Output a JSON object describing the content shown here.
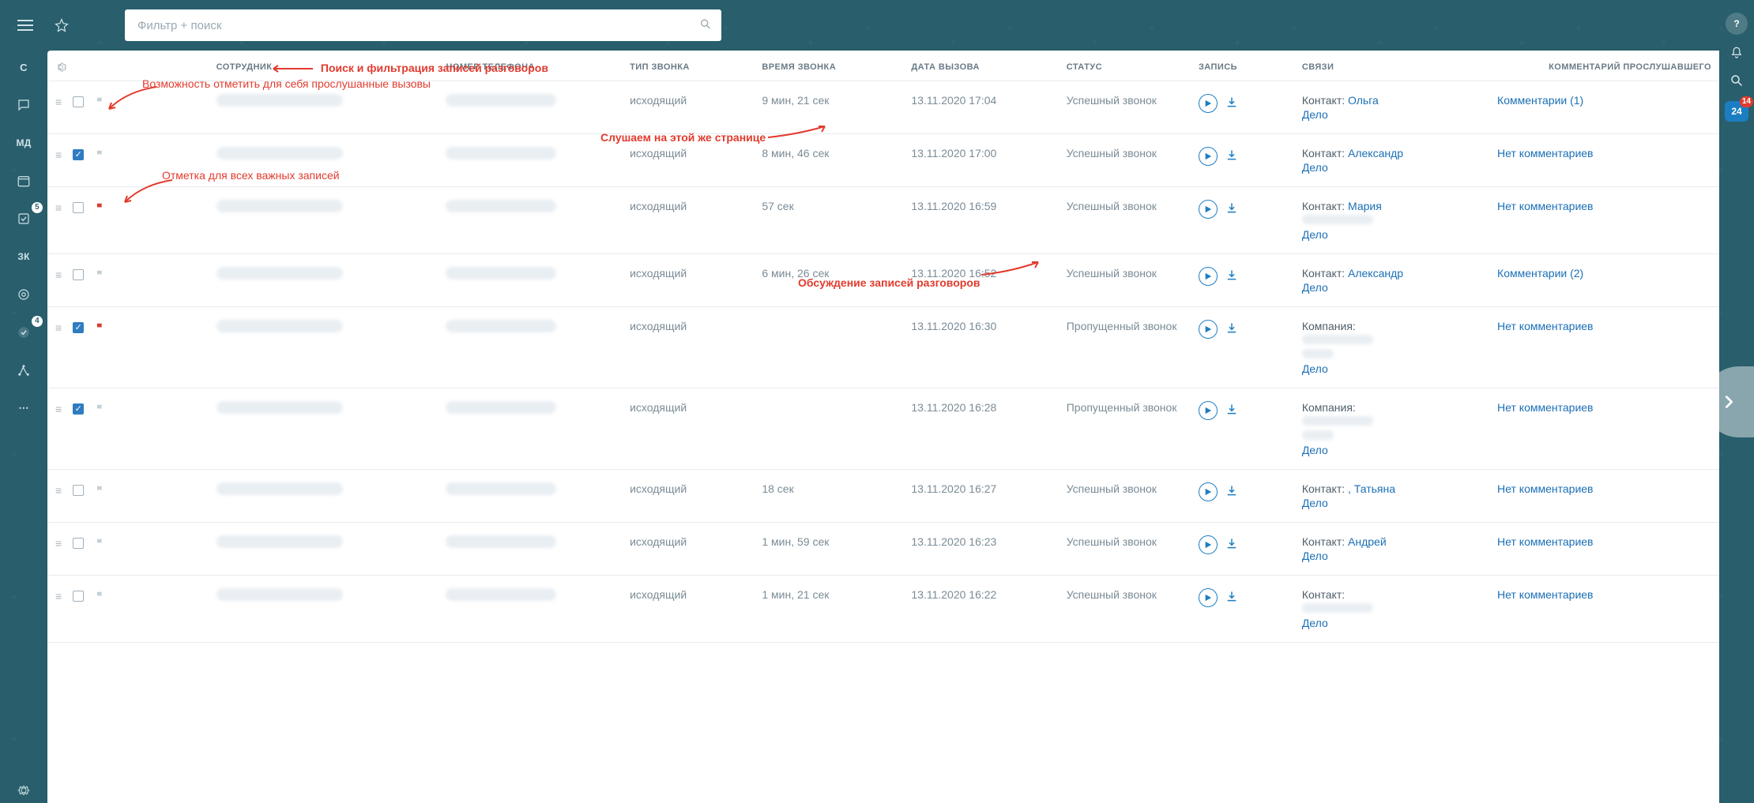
{
  "search": {
    "placeholder": "Фильтр + поиск"
  },
  "annotations": {
    "search": "Поиск и фильтрация записей разговоров",
    "self_check": "Возможность отметить для себя прослушанные вызовы",
    "flag_important": "Отметка для всех важных записей",
    "listen_inline": "Слушаем на этой же странице",
    "discussion": "Обсуждение записей разговоров"
  },
  "sidebar": {
    "items": [
      "С",
      "",
      "МД",
      "",
      "",
      "ЗК",
      "",
      "",
      "",
      ""
    ],
    "badge_box": 5,
    "badge_accept": 4
  },
  "rail": {
    "brand_num": "24",
    "brand_badge": "14"
  },
  "headers": {
    "employee": "СОТРУДНИК",
    "phone": "НОМЕР ТЕЛЕФОНА",
    "type": "ТИП ЗВОНКА",
    "duration": "ВРЕМЯ ЗВОНКА",
    "date": "ДАТА ВЫЗОВА",
    "status": "СТАТУС",
    "record": "ЗАПИСЬ",
    "relations": "СВЯЗИ",
    "comment": "КОММЕНТАРИЙ ПРОСЛУШАВШЕГО"
  },
  "labels": {
    "contact": "Контакт:",
    "company": "Компания:",
    "deal": "Дело"
  },
  "rows": [
    {
      "checked": false,
      "flag": "gray",
      "type": "исходящий",
      "duration": "9 мин, 21 сек",
      "date": "13.11.2020 17:04",
      "status": "Успешный звонок",
      "relation_kind": "contact",
      "contact": "Ольга",
      "contact_extra": false,
      "comment": "Комментарии (1)"
    },
    {
      "checked": true,
      "flag": "gray",
      "type": "исходящий",
      "duration": "8 мин, 46 сек",
      "date": "13.11.2020 17:00",
      "status": "Успешный звонок",
      "relation_kind": "contact",
      "contact": "Александр",
      "contact_extra": false,
      "comment": "Нет комментариев"
    },
    {
      "checked": false,
      "flag": "red",
      "type": "исходящий",
      "duration": "57 сек",
      "date": "13.11.2020 16:59",
      "status": "Успешный звонок",
      "relation_kind": "contact",
      "contact": "Мария",
      "contact_extra": true,
      "comment": "Нет комментариев"
    },
    {
      "checked": false,
      "flag": "gray",
      "type": "исходящий",
      "duration": "6 мин, 26 сек",
      "date": "13.11.2020 16:52",
      "status": "Успешный звонок",
      "relation_kind": "contact",
      "contact": "Александр",
      "contact_extra": false,
      "comment": "Комментарии (2)"
    },
    {
      "checked": true,
      "flag": "red",
      "type": "исходящий",
      "duration": "",
      "date": "13.11.2020 16:30",
      "status": "Пропущенный звонок",
      "relation_kind": "company",
      "contact": "",
      "contact_extra": true,
      "comment": "Нет комментариев"
    },
    {
      "checked": true,
      "flag": "gray",
      "type": "исходящий",
      "duration": "",
      "date": "13.11.2020 16:28",
      "status": "Пропущенный звонок",
      "relation_kind": "company",
      "contact": "",
      "contact_extra": true,
      "comment": "Нет комментариев"
    },
    {
      "checked": false,
      "flag": "gray",
      "type": "исходящий",
      "duration": "18 сек",
      "date": "13.11.2020 16:27",
      "status": "Успешный звонок",
      "relation_kind": "contact",
      "contact": ", Татьяна",
      "contact_extra": false,
      "comment": "Нет комментариев"
    },
    {
      "checked": false,
      "flag": "gray",
      "type": "исходящий",
      "duration": "1 мин, 59 сек",
      "date": "13.11.2020 16:23",
      "status": "Успешный звонок",
      "relation_kind": "contact",
      "contact": "Андрей",
      "contact_extra": false,
      "comment": "Нет комментариев"
    },
    {
      "checked": false,
      "flag": "gray",
      "type": "исходящий",
      "duration": "1 мин, 21 сек",
      "date": "13.11.2020 16:22",
      "status": "Успешный звонок",
      "relation_kind": "contact",
      "contact": "",
      "contact_extra": true,
      "comment": "Нет комментариев"
    }
  ]
}
